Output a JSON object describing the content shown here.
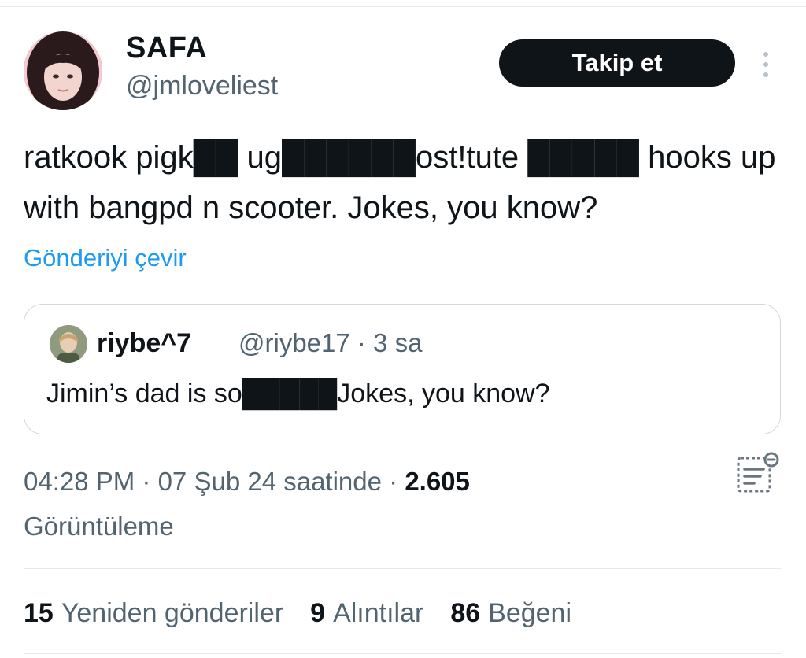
{
  "author": {
    "display_name": "SAFA",
    "handle": "@jmloveliest"
  },
  "actions": {
    "follow_label": "Takip et",
    "more_icon": "more-vertical-icon"
  },
  "tweet": {
    "text": "ratkook pigk██ ug██████ost!tute █████ hooks up with bangpd n scooter. Jokes, you know?",
    "translate_label": "Gönderiyi çevir"
  },
  "quote": {
    "display_name": "riybe^7",
    "meta": "@riybe17 · 3 sa",
    "text": "Jimin’s dad is so█████Jokes, you know?"
  },
  "meta": {
    "time": "04:28 PM · 07 Şub 24 saatinde · ",
    "views_count": "2.605",
    "views_label": "Görüntüleme",
    "analytics_icon": "post-analytics-icon"
  },
  "stats": {
    "reposts_count": "15",
    "reposts_label": "Yeniden gönderiler",
    "quotes_count": "9",
    "quotes_label": "Alıntılar",
    "likes_count": "86",
    "likes_label": "Beğeni"
  },
  "colors": {
    "text": "#0f1419",
    "secondary": "#536471",
    "link": "#1d9bf0",
    "border": "#cfd9de",
    "redaction": "#7a7a7a"
  }
}
